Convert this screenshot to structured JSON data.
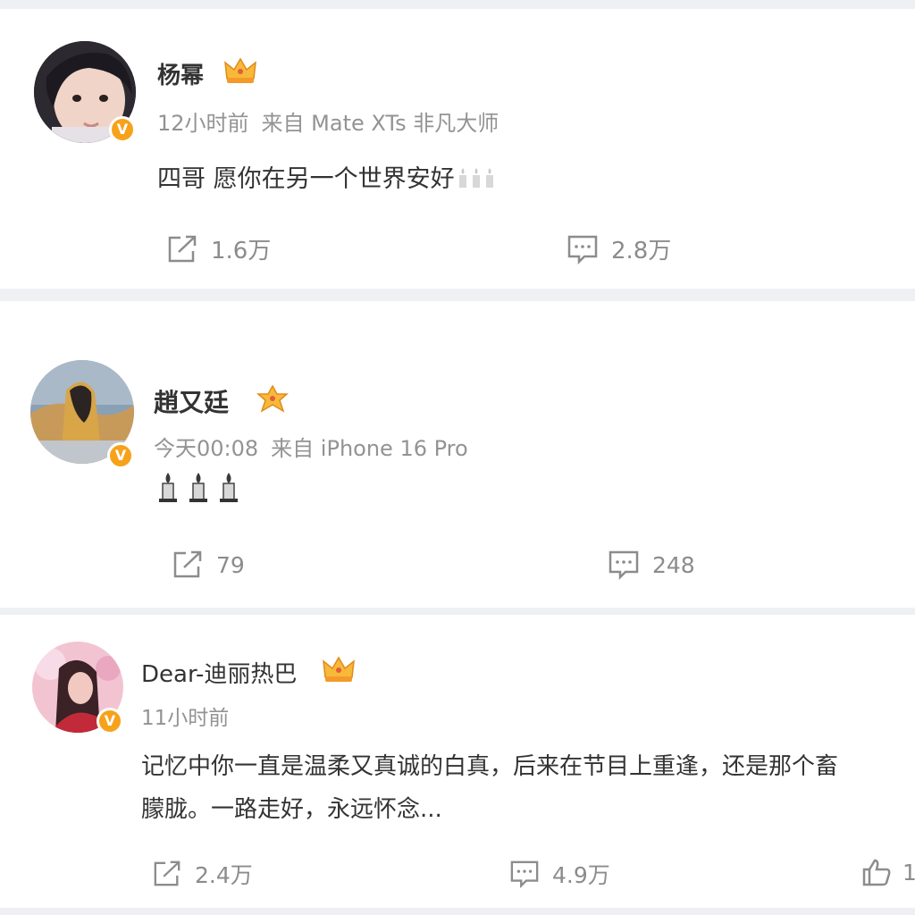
{
  "posts": [
    {
      "username": "杨幂",
      "time": "12小时前",
      "source": "来自 Mate XTs 非凡大师",
      "content": "四哥 愿你在另一个世界安好",
      "emoji": "candle-icon",
      "repost_count": "1.6万",
      "comment_count": "2.8万"
    },
    {
      "username": "趙又廷",
      "time": "今天00:08",
      "source": "来自 iPhone 16 Pro",
      "emoji": "candle-icon",
      "repost_count": "79",
      "comment_count": "248"
    },
    {
      "username": "Dear-迪丽热巴",
      "time": "11小时前",
      "content_line1": "记忆中你一直是温柔又真诚的白真，后来在节目上重逢，还是那个畜",
      "content_line2": "朦胧。一路走好，永远怀念...",
      "repost_count": "2.4万",
      "comment_count": "4.9万",
      "like_count": "1"
    }
  ],
  "colors": {
    "page_bg": "#eef0f3",
    "card_bg": "#ffffff",
    "name": "#333333",
    "meta": "#939393",
    "action": "#8c8c8c",
    "verified_badge": "#f7a21b"
  }
}
